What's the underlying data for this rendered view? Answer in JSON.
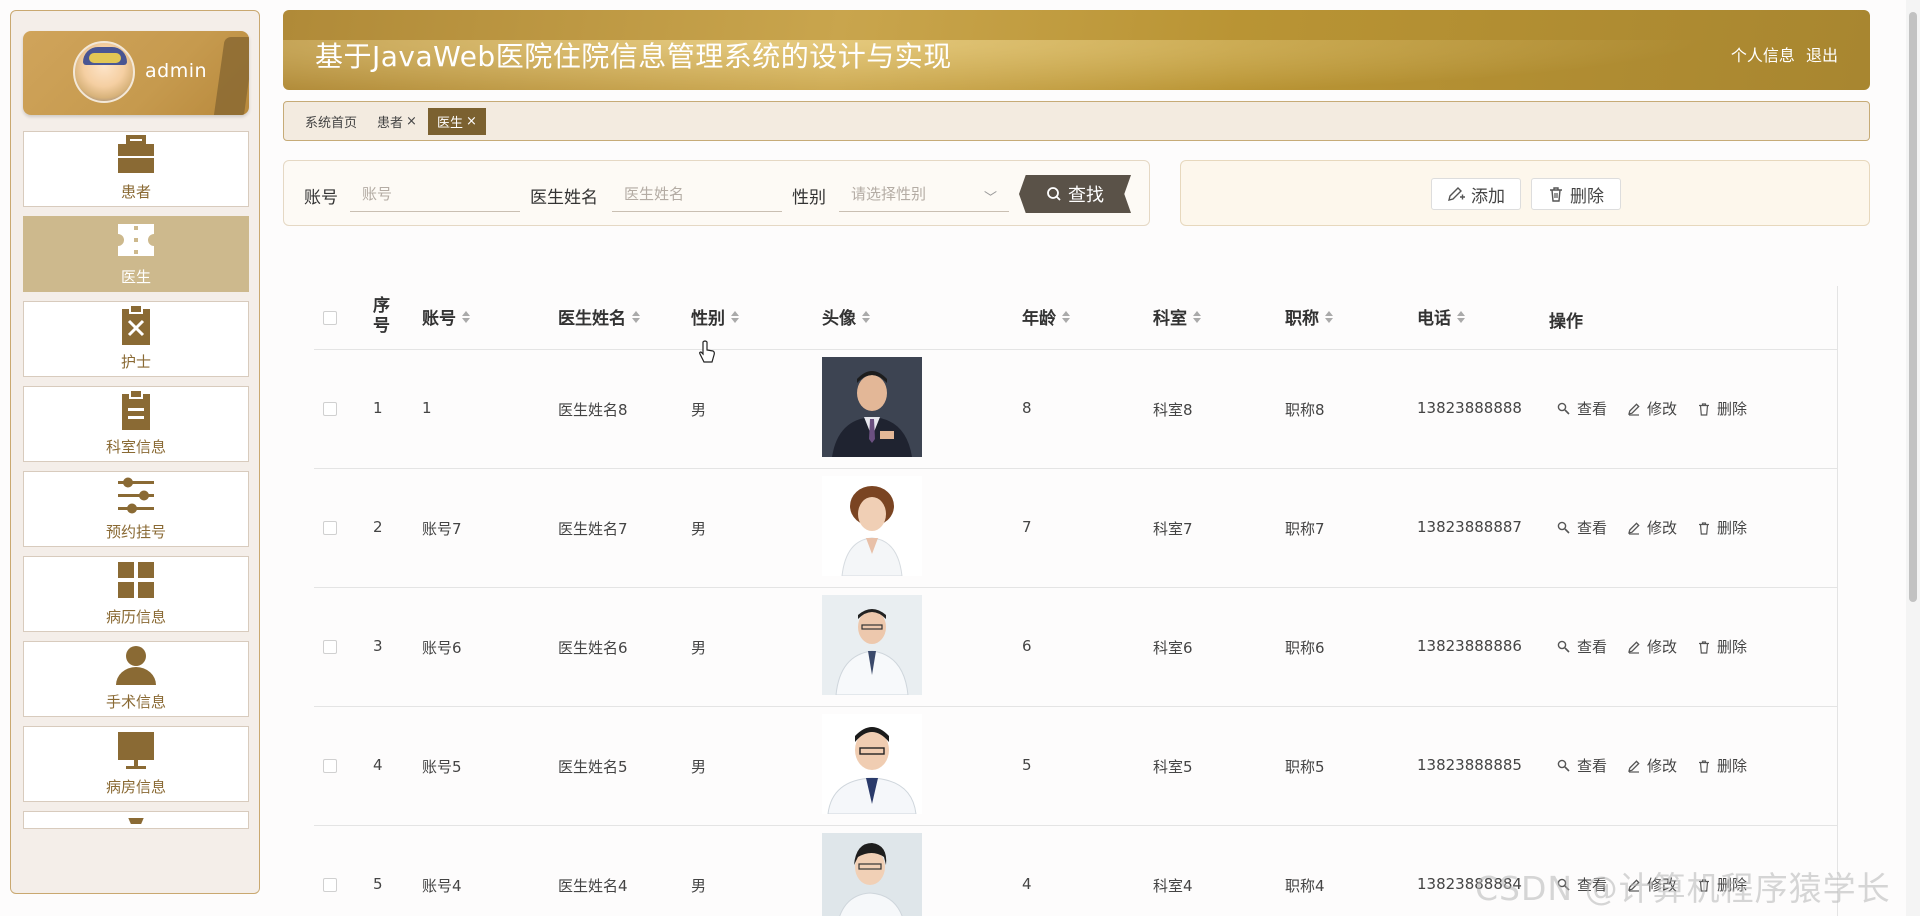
{
  "colors": {
    "brand": "#c69a4e",
    "menu_active": "#cdb98d",
    "icon_brown": "#8a6a34"
  },
  "user": {
    "name": "admin"
  },
  "menu": [
    {
      "label": "患者",
      "icon": "briefcase-icon",
      "active": false
    },
    {
      "label": "医生",
      "icon": "ticket-icon",
      "active": true
    },
    {
      "label": "护士",
      "icon": "clipboard-x-icon",
      "active": false
    },
    {
      "label": "科室信息",
      "icon": "clipboard-icon",
      "active": false
    },
    {
      "label": "预约挂号",
      "icon": "sliders-icon",
      "active": false
    },
    {
      "label": "病历信息",
      "icon": "grid-icon",
      "active": false
    },
    {
      "label": "手术信息",
      "icon": "user-icon",
      "active": false
    },
    {
      "label": "病房信息",
      "icon": "monitor-icon",
      "active": false
    }
  ],
  "header": {
    "title": "基于JavaWeb医院住院信息管理系统的设计与实现",
    "profile_link": "个人信息",
    "logout_link": "退出"
  },
  "tabs": [
    {
      "label": "系统首页",
      "closable": false,
      "active": false
    },
    {
      "label": "患者",
      "closable": true,
      "active": false
    },
    {
      "label": "医生",
      "closable": true,
      "active": true
    }
  ],
  "search": {
    "account_label": "账号",
    "account_placeholder": "账号",
    "name_label": "医生姓名",
    "name_placeholder": "医生姓名",
    "gender_label": "性别",
    "gender_placeholder": "请选择性别",
    "button": "查找"
  },
  "actions": {
    "add": "添加",
    "delete": "删除"
  },
  "table": {
    "columns": [
      "序号",
      "账号",
      "医生姓名",
      "性别",
      "头像",
      "年龄",
      "科室",
      "职称",
      "电话",
      "操作"
    ],
    "ops": {
      "view": "查看",
      "edit": "修改",
      "delete": "删除"
    },
    "rows": [
      {
        "index": "1",
        "account": "1",
        "name": "医生姓名8",
        "gender": "男",
        "age": "8",
        "dept": "科室8",
        "title": "职称8",
        "phone": "13823888888"
      },
      {
        "index": "2",
        "account": "账号7",
        "name": "医生姓名7",
        "gender": "男",
        "age": "7",
        "dept": "科室7",
        "title": "职称7",
        "phone": "13823888887"
      },
      {
        "index": "3",
        "account": "账号6",
        "name": "医生姓名6",
        "gender": "男",
        "age": "6",
        "dept": "科室6",
        "title": "职称6",
        "phone": "13823888886"
      },
      {
        "index": "4",
        "account": "账号5",
        "name": "医生姓名5",
        "gender": "男",
        "age": "5",
        "dept": "科室5",
        "title": "职称5",
        "phone": "13823888885"
      },
      {
        "index": "5",
        "account": "账号4",
        "name": "医生姓名4",
        "gender": "男",
        "age": "4",
        "dept": "科室4",
        "title": "职称4",
        "phone": "13823888884"
      }
    ]
  },
  "watermark": "CSDN @计算机程序猿学长"
}
